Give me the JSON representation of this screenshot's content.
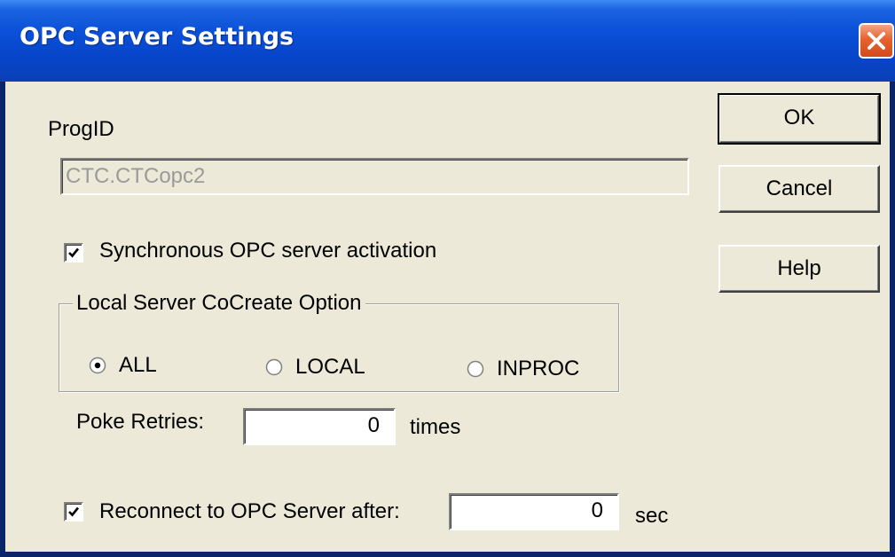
{
  "window": {
    "title": "OPC Server Settings"
  },
  "progid": {
    "label": "ProgID",
    "value": "CTC.CTCopc2"
  },
  "sync_activation": {
    "label": "Synchronous OPC server activation",
    "checked": true
  },
  "cocreate_group": {
    "legend": "Local Server CoCreate Option",
    "options": [
      {
        "label": "ALL",
        "selected": true
      },
      {
        "label": "LOCAL",
        "selected": false
      },
      {
        "label": "INPROC",
        "selected": false
      }
    ]
  },
  "poke_retries": {
    "label": "Poke Retries:",
    "value": "0",
    "unit": "times"
  },
  "reconnect": {
    "label": "Reconnect to OPC Server after:",
    "checked": true,
    "value": "0",
    "unit": "sec"
  },
  "buttons": {
    "ok": "OK",
    "cancel": "Cancel",
    "help": "Help"
  },
  "icons": {
    "close": "close-icon",
    "check": "checkmark-icon",
    "radio_on": "radio-selected-icon",
    "radio_off": "radio-unselected-icon"
  },
  "colors": {
    "titlebar": "#0a50d8",
    "dialog_bg": "#ece9d8",
    "close_button": "#d34a1d",
    "disabled_text": "#9a9a9a"
  }
}
